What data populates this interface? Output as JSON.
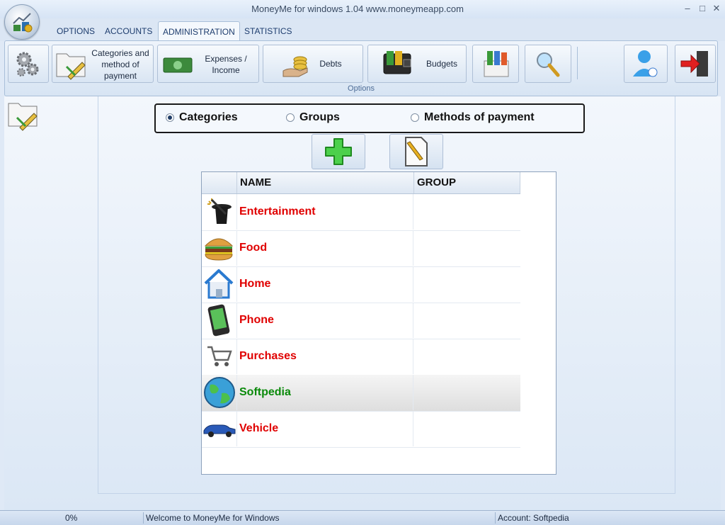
{
  "window": {
    "title": "MoneyMe for windows 1.04 www.moneymeapp.com"
  },
  "tabs": [
    {
      "label": "OPTIONS"
    },
    {
      "label": "ACCOUNTS"
    },
    {
      "label": "ADMINISTRATION",
      "active": true
    },
    {
      "label": "STATISTICS"
    }
  ],
  "ribbon": {
    "categories_label": "Categories and method of payment",
    "expenses_label": "Expenses / Income",
    "debts_label": "Debts",
    "budgets_label": "Budgets",
    "group_label": "Options"
  },
  "filter": {
    "options": [
      "Categories",
      "Groups",
      "Methods of payment"
    ],
    "selected": "Categories"
  },
  "table": {
    "columns": [
      "NAME",
      "GROUP"
    ],
    "rows": [
      {
        "name": "Entertainment",
        "group": "",
        "icon": "magic-hat-icon"
      },
      {
        "name": "Food",
        "group": "",
        "icon": "burger-icon"
      },
      {
        "name": "Home",
        "group": "",
        "icon": "house-icon"
      },
      {
        "name": "Phone",
        "group": "",
        "icon": "phone-icon"
      },
      {
        "name": "Purchases",
        "group": "",
        "icon": "cart-icon"
      },
      {
        "name": "Softpedia",
        "group": "",
        "icon": "globe-icon",
        "selected": true
      },
      {
        "name": "Vehicle",
        "group": "",
        "icon": "car-icon"
      }
    ]
  },
  "status": {
    "progress": "0%",
    "message": "Welcome to MoneyMe for Windows",
    "account": "Account: Softpedia"
  },
  "colors": {
    "accent": "#1e3d6e",
    "row_text": "#e00000",
    "selected_text": "#0a8a0a"
  }
}
